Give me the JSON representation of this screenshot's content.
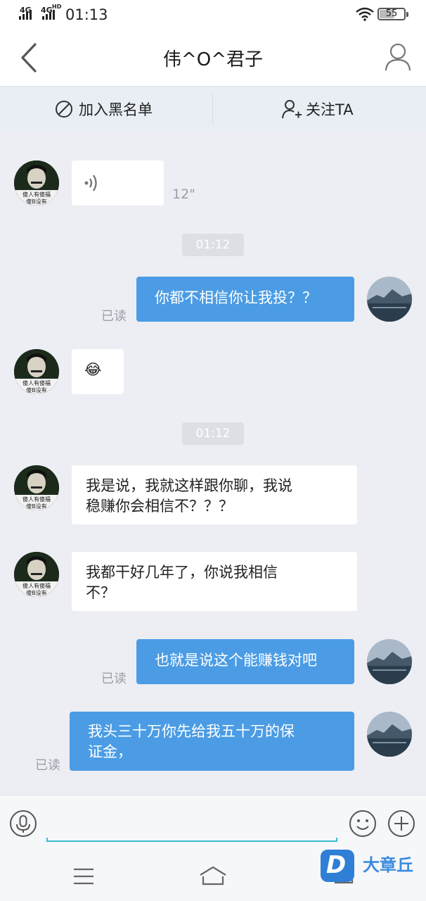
{
  "status_bar": {
    "signal1": "4G",
    "signal2": "4G",
    "signal2_sup": "HD",
    "time": "01:13",
    "battery": "55"
  },
  "header": {
    "title": "伟^O^君子"
  },
  "actions": {
    "blacklist_label": "加入黑名单",
    "follow_label": "关注TA"
  },
  "messages": {
    "voice_duration": "12\"",
    "time1": "01:12",
    "m1": "你都不相信你让我投？？",
    "read1": "已读",
    "emoji": "😂",
    "time2": "01:12",
    "m2_line1": "我是说，我就这样跟你聊，我说",
    "m2_line2": "稳赚你会相信不？？？",
    "m3_line1": "我都干好几年了，你说我相信",
    "m3_line2": "不？",
    "m4": "也就是说这个能赚钱对吧",
    "read2": "已读",
    "m5_line1": "我头三十万你先给我五十万的保",
    "m5_line2": "证金，",
    "read3": "已读"
  },
  "avatar_caption": {
    "line1": "傻人有傻福",
    "line2": "傻B没有"
  },
  "watermark": {
    "text": "大章丘",
    "logo_letter": "D"
  },
  "colors": {
    "accent": "#4b9ce4",
    "chat_bg": "#eceef3",
    "action_bar_bg": "#e9eef5",
    "input_underline": "#3db8d2"
  }
}
